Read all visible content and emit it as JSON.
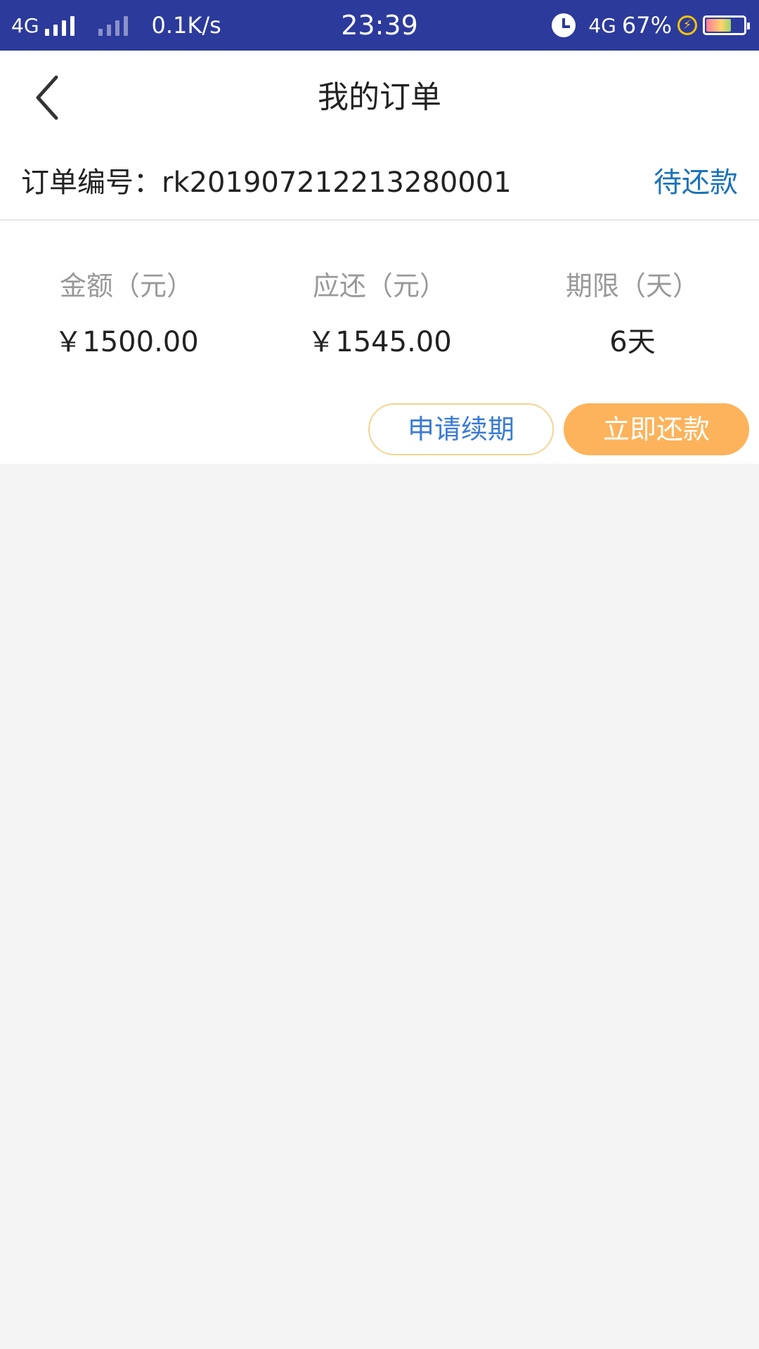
{
  "statusbar": {
    "network": "4G",
    "speed": "0.1K/s",
    "time": "23:39",
    "network2": "4G",
    "battery_percent": "67%",
    "charging_icon": "lightning-bolt-icon"
  },
  "header": {
    "title": "我的订单",
    "back_icon": "chevron-left-icon"
  },
  "order": {
    "number_label": "订单编号：rk201907212213280001",
    "status": "待还款"
  },
  "summary": {
    "columns": [
      {
        "label": "金额（元）",
        "value": "￥1500.00"
      },
      {
        "label": "应还（元）",
        "value": "￥1545.00"
      },
      {
        "label": "期限（天）",
        "value": "6天"
      }
    ]
  },
  "actions": {
    "renew_label": "申请续期",
    "pay_label": "立即还款"
  },
  "colors": {
    "statusbar_bg": "#2c3a9c",
    "status_text": "#1a73b8",
    "pay_button": "#fdb35b",
    "renew_border": "#f4d48f",
    "renew_text": "#3a7bd5"
  }
}
